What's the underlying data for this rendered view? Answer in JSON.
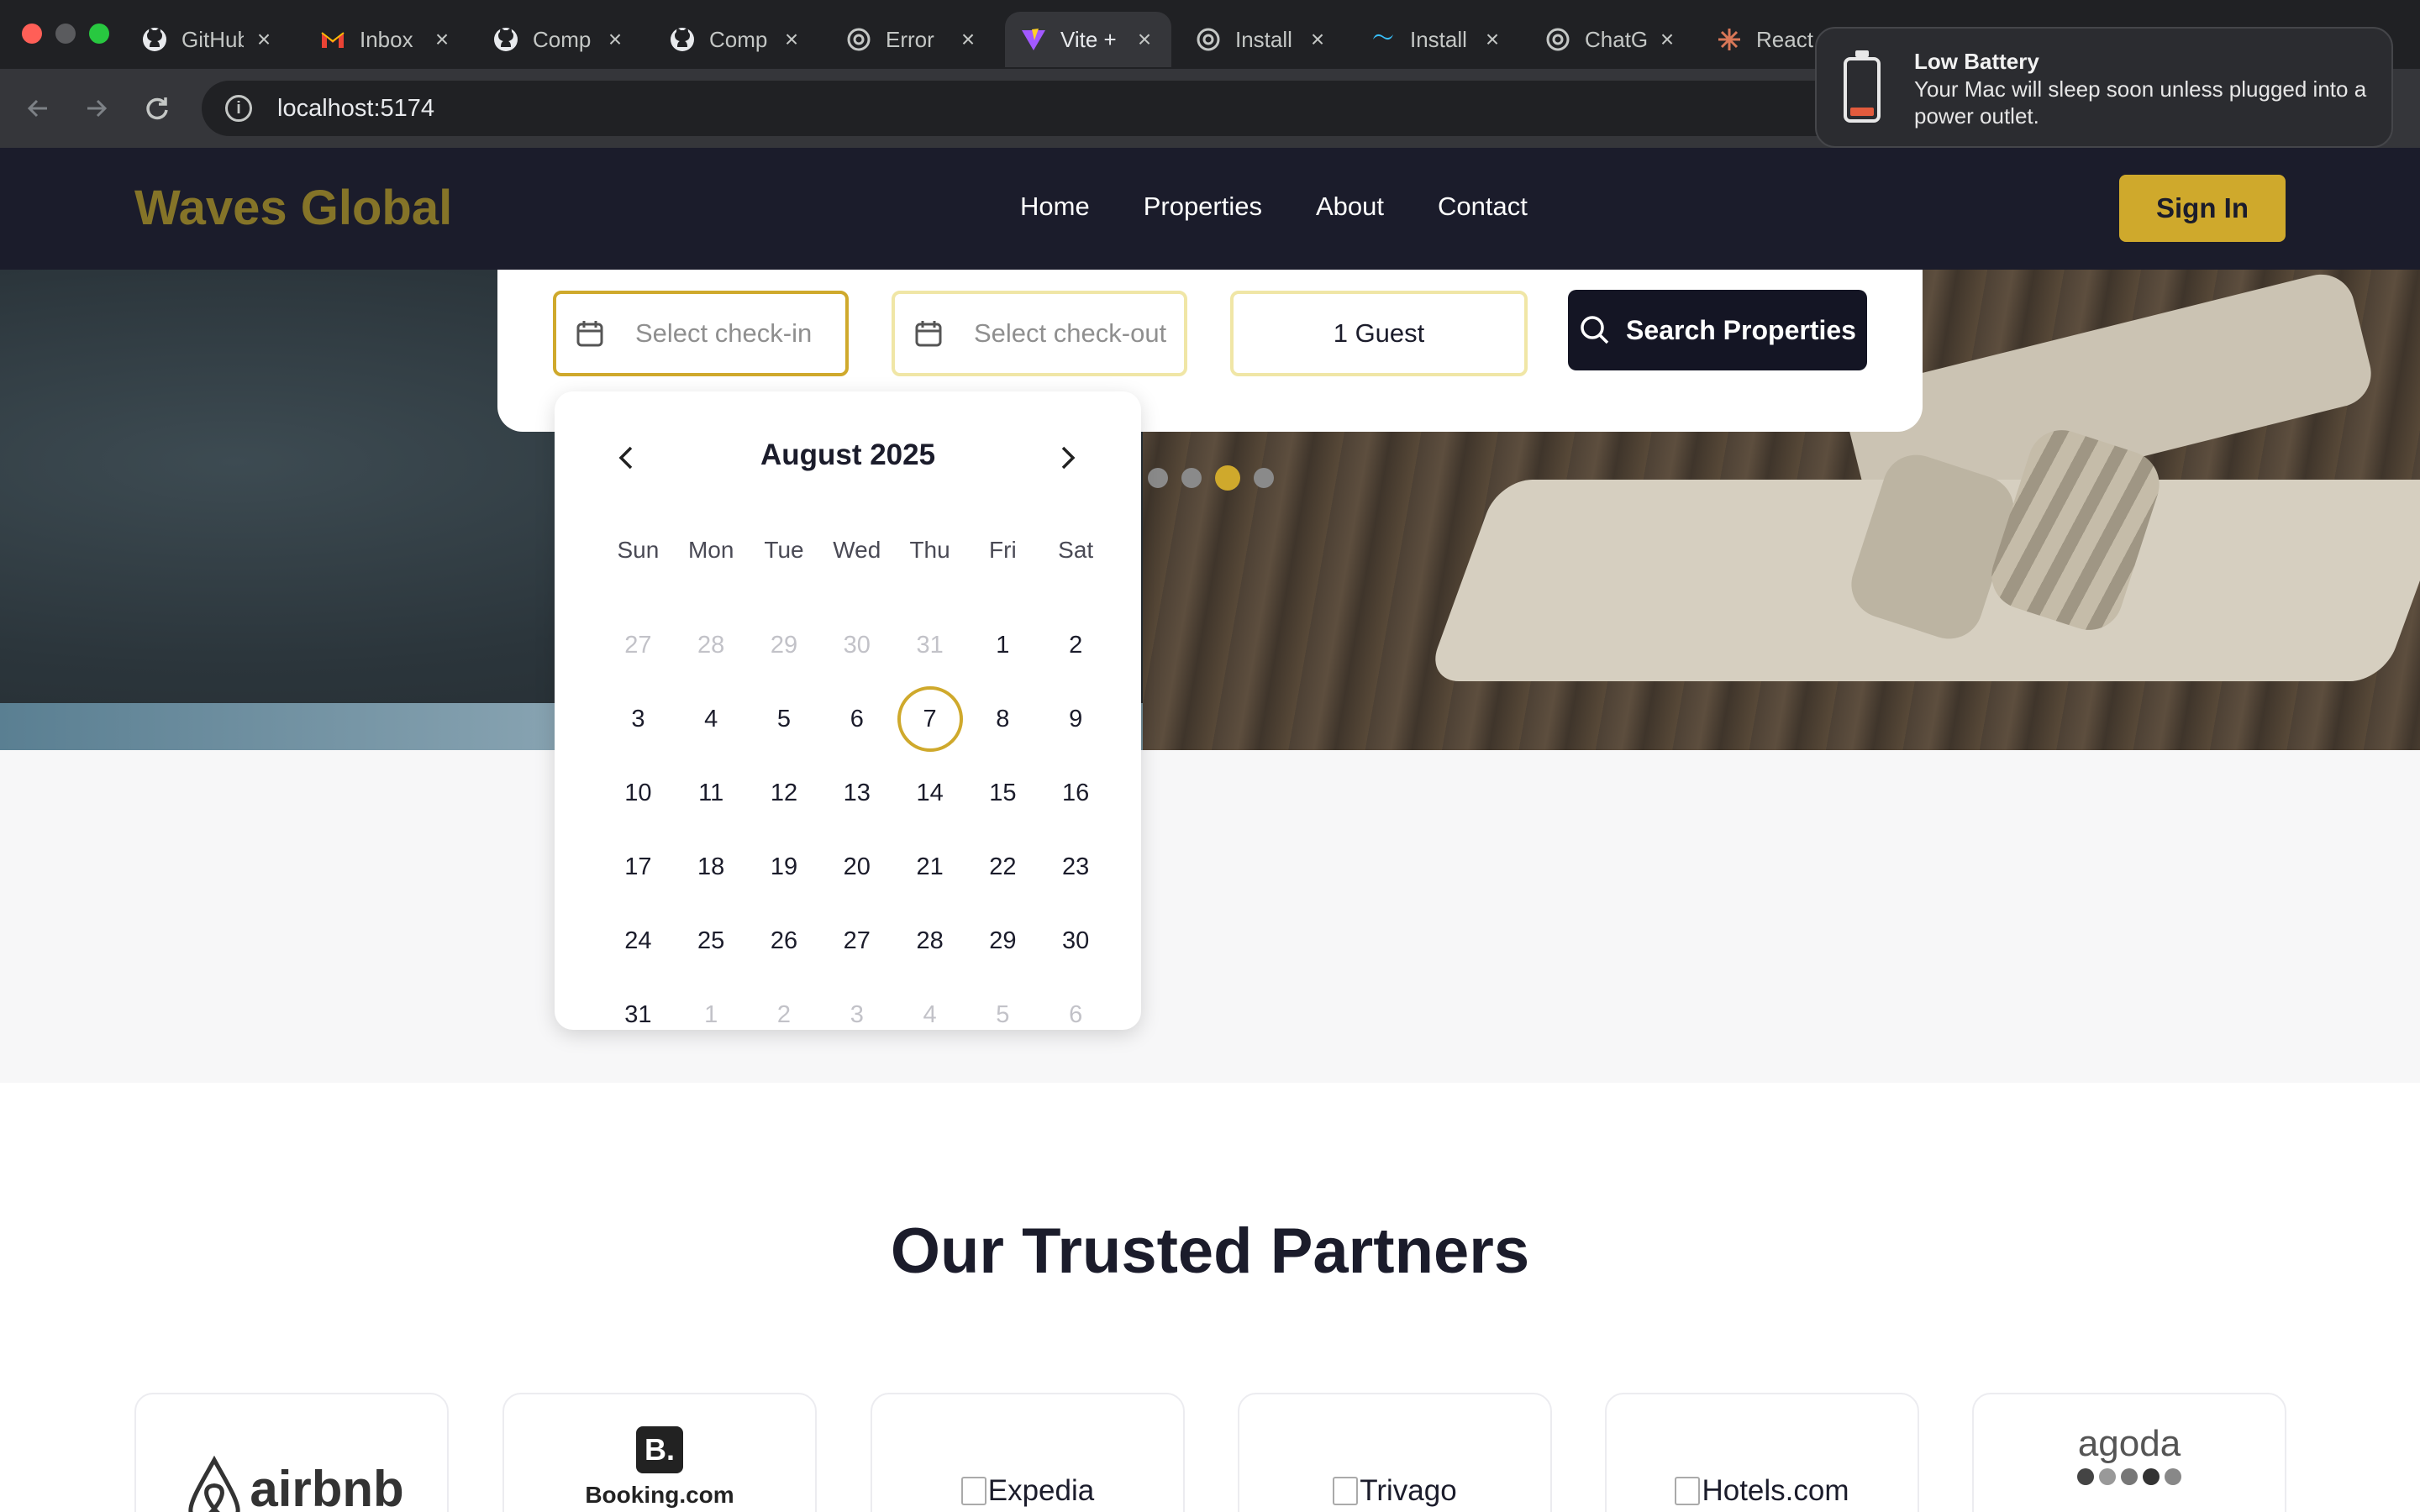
{
  "browser": {
    "tabs": [
      {
        "label": "GitHub",
        "icon": "github-icon"
      },
      {
        "label": "Inbox",
        "icon": "gmail-icon"
      },
      {
        "label": "Comp",
        "icon": "github-icon"
      },
      {
        "label": "Comp",
        "icon": "github-icon"
      },
      {
        "label": "Error",
        "icon": "openai-icon"
      },
      {
        "label": "Vite +",
        "icon": "vite-icon",
        "active": true
      },
      {
        "label": "Install",
        "icon": "openai-icon"
      },
      {
        "label": "Install",
        "icon": "tailwind-icon"
      },
      {
        "label": "ChatG",
        "icon": "openai-icon"
      },
      {
        "label": "React",
        "icon": "claude-icon"
      }
    ],
    "url": "localhost:5174"
  },
  "notification": {
    "title": "Low Battery",
    "body": "Your Mac will sleep soon unless plugged into a power outlet."
  },
  "header": {
    "logo": "Waves Global",
    "nav": [
      "Home",
      "Properties",
      "About",
      "Contact"
    ],
    "signin": "Sign In"
  },
  "search": {
    "checkin_placeholder": "Select check-in",
    "checkout_placeholder": "Select check-out",
    "guests": "1 Guest",
    "button": "Search Properties"
  },
  "carousel": {
    "slide_count": 4,
    "active_index": 2
  },
  "calendar": {
    "month_label": "August 2025",
    "weekdays": [
      "Sun",
      "Mon",
      "Tue",
      "Wed",
      "Thu",
      "Fri",
      "Sat"
    ],
    "weeks": [
      [
        "27",
        "28",
        "29",
        "30",
        "31",
        "1",
        "2"
      ],
      [
        "3",
        "4",
        "5",
        "6",
        "7",
        "8",
        "9"
      ],
      [
        "10",
        "11",
        "12",
        "13",
        "14",
        "15",
        "16"
      ],
      [
        "17",
        "18",
        "19",
        "20",
        "21",
        "22",
        "23"
      ],
      [
        "24",
        "25",
        "26",
        "27",
        "28",
        "29",
        "30"
      ],
      [
        "31",
        "1",
        "2",
        "3",
        "4",
        "5",
        "6"
      ]
    ],
    "selected_day": "7"
  },
  "partners": {
    "title": "Our Trusted Partners",
    "items": [
      {
        "name": "airbnb",
        "type": "logo"
      },
      {
        "name": "Booking.com",
        "type": "logo"
      },
      {
        "name": "Expedia",
        "type": "broken-image"
      },
      {
        "name": "Trivago",
        "type": "broken-image"
      },
      {
        "name": "Hotels.com",
        "type": "broken-image"
      },
      {
        "name": "agoda",
        "type": "logo"
      }
    ]
  },
  "colors": {
    "accent": "#cfa92c",
    "header_bg": "#1b1c2b",
    "logo": "#857428",
    "search_button": "#141524"
  }
}
